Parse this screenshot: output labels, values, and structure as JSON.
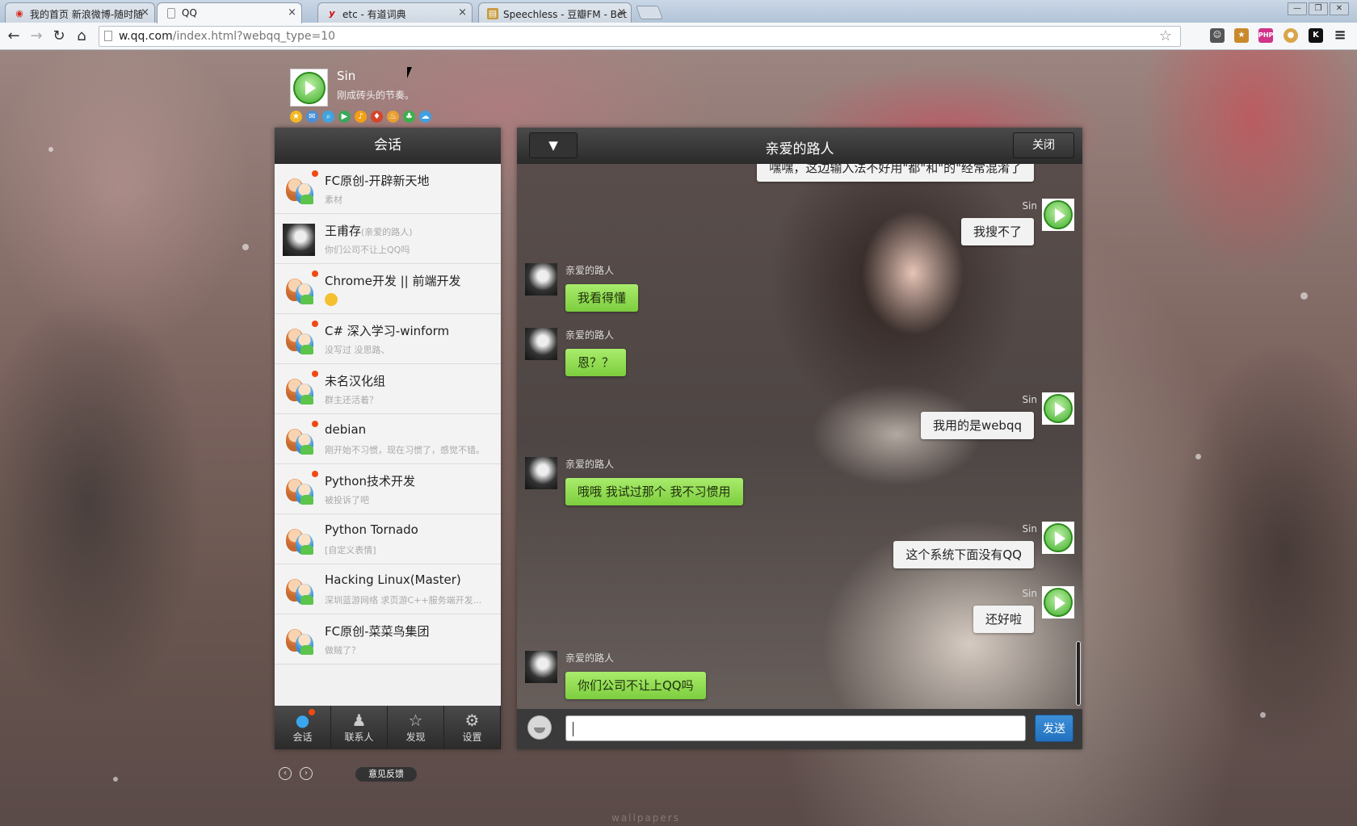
{
  "browser": {
    "tabs": [
      {
        "title": "我的首页 新浪微博-随时随",
        "icon": "weibo-icon",
        "color": "#d52b1e"
      },
      {
        "title": "QQ",
        "icon": "page-icon",
        "color": "#888888"
      },
      {
        "title": "etc - 有道词典",
        "icon": "youdao-icon",
        "color": "#d50000"
      },
      {
        "title": "Speechless - 豆瓣FM - Bet",
        "icon": "douban-icon",
        "color": "#c59a3a"
      }
    ],
    "url_host": "w.qq.com",
    "url_path": "/index.html?webqq_type=10"
  },
  "profile": {
    "name": "Sin",
    "signature": "刚成砖头的节奏。"
  },
  "sidebar": {
    "title": "会话",
    "conversations": [
      {
        "name": "FC原创-开辟新天地",
        "note": "",
        "preview": "素材"
      },
      {
        "name": "王甫存",
        "note": "(亲爱的路人)",
        "preview": "你们公司不让上QQ吗"
      },
      {
        "name": "Chrome开发 || 前端开发",
        "note": "",
        "preview": ""
      },
      {
        "name": "C# 深入学习-winform",
        "note": "",
        "preview": "没写过 没思路、"
      },
      {
        "name": "未名汉化组",
        "note": "",
        "preview": "群主还活着？"
      },
      {
        "name": "debian",
        "note": "",
        "preview": "刚开始不习惯，现在习惯了，感觉不错。"
      },
      {
        "name": "Python技术开发",
        "note": "",
        "preview": "被投诉了吧"
      },
      {
        "name": "Python Tornado",
        "note": "",
        "preview": "[自定义表情]"
      },
      {
        "name": "Hacking Linux(Master)",
        "note": "",
        "preview": "深圳蓝游网络 求页游C++服务端开发..."
      },
      {
        "name": "FC原创-菜菜鸟集团",
        "note": "",
        "preview": "做贼了？"
      }
    ],
    "footer": [
      {
        "label": "会话",
        "icon": "chat-bubble-icon"
      },
      {
        "label": "联系人",
        "icon": "contact-person-icon"
      },
      {
        "label": "发现",
        "icon": "star-icon"
      },
      {
        "label": "设置",
        "icon": "gear-icon"
      }
    ],
    "feedback_label": "意见反馈"
  },
  "chat": {
    "title": "亲爱的路人",
    "close_label": "关闭",
    "dropdown_label": "▼",
    "messages": [
      {
        "from": "me",
        "sender": "",
        "text": "嘿嘿，这边输入法不好用\"都\"和\"的\"经常混淆了"
      },
      {
        "from": "me",
        "sender": "Sin",
        "text": "我搜不了"
      },
      {
        "from": "them",
        "sender": "亲爱的路人",
        "text": "我看得懂"
      },
      {
        "from": "them",
        "sender": "亲爱的路人",
        "text": "恩？？"
      },
      {
        "from": "me",
        "sender": "Sin",
        "text": "我用的是webqq"
      },
      {
        "from": "them",
        "sender": "亲爱的路人",
        "text": "哦哦 我试过那个 我不习惯用"
      },
      {
        "from": "me",
        "sender": "Sin",
        "text": "这个系统下面没有QQ"
      },
      {
        "from": "me",
        "sender": "Sin",
        "text": "还好啦"
      },
      {
        "from": "them",
        "sender": "亲爱的路人",
        "text": "你们公司不让上QQ吗"
      }
    ],
    "input_value": "",
    "send_label": "发送"
  },
  "watermark": "wallpapers"
}
